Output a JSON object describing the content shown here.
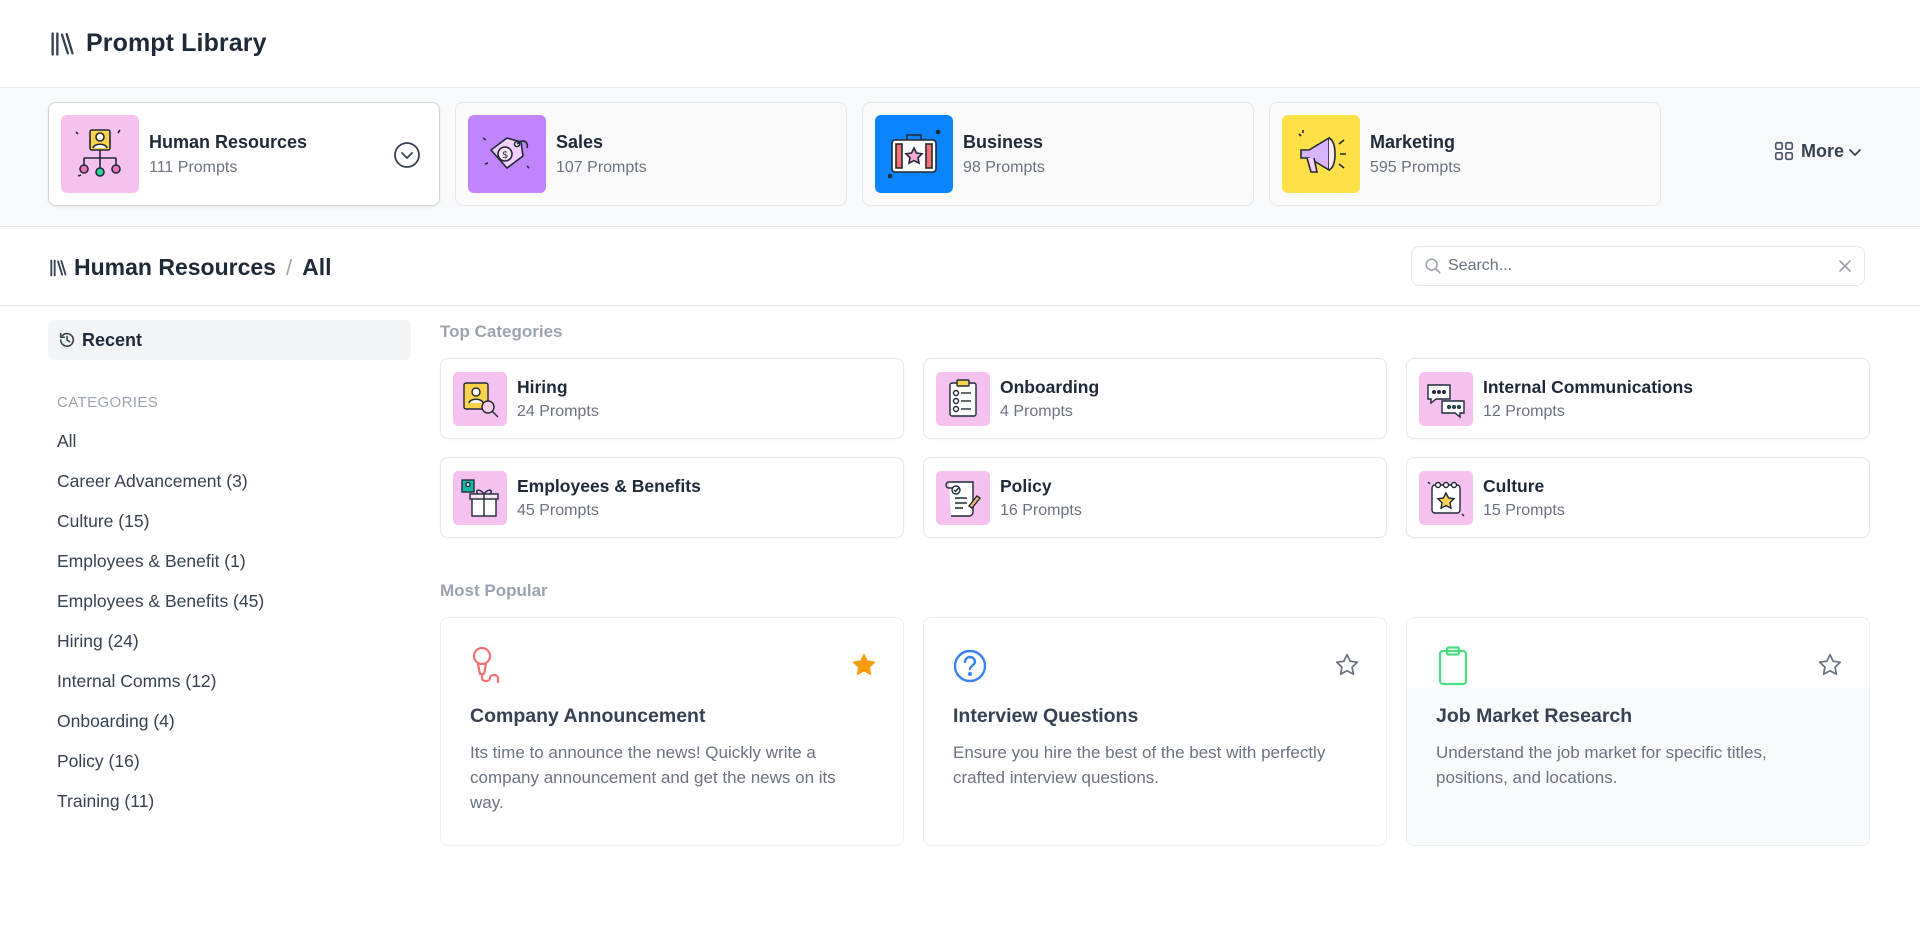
{
  "app": {
    "title": "Prompt Library"
  },
  "categories_strip": [
    {
      "name": "Human Resources",
      "count": "111 Prompts",
      "thumb_color": "#f5c2f0",
      "icon": "org-chart-icon"
    },
    {
      "name": "Sales",
      "count": "107 Prompts",
      "thumb_color": "#c084fc",
      "icon": "price-tag-icon"
    },
    {
      "name": "Business",
      "count": "98 Prompts",
      "thumb_color": "#0a84ff",
      "icon": "briefcase-icon"
    },
    {
      "name": "Marketing",
      "count": "595 Prompts",
      "thumb_color": "#fde047",
      "icon": "megaphone-icon"
    }
  ],
  "more": {
    "label": "More"
  },
  "breadcrumb": {
    "section": "Human Resources",
    "separator": "/",
    "current": "All"
  },
  "search": {
    "placeholder": "Search..."
  },
  "sidebar": {
    "recent_label": "Recent",
    "heading": "CATEGORIES",
    "items": [
      "All",
      "Career Advancement (3)",
      "Culture (15)",
      "Employees & Benefit (1)",
      "Employees & Benefits (45)",
      "Hiring (24)",
      "Internal Comms (12)",
      "Onboarding (4)",
      "Policy (16)",
      "Training (11)"
    ]
  },
  "top_categories": {
    "title": "Top Categories",
    "items": [
      {
        "name": "Hiring",
        "count": "24 Prompts",
        "icon": "magnifier-person-icon"
      },
      {
        "name": "Onboarding",
        "count": "4 Prompts",
        "icon": "checklist-icon"
      },
      {
        "name": "Internal Communications",
        "count": "12 Prompts",
        "icon": "chat-bubbles-icon"
      },
      {
        "name": "Employees & Benefits",
        "count": "45 Prompts",
        "icon": "gift-icon"
      },
      {
        "name": "Policy",
        "count": "16 Prompts",
        "icon": "scroll-icon"
      },
      {
        "name": "Culture",
        "count": "15 Prompts",
        "icon": "calendar-star-icon"
      }
    ]
  },
  "most_popular": {
    "title": "Most Popular",
    "items": [
      {
        "name": "Company Announcement",
        "description": "Its time to announce the news! Quickly write a company announcement and get the news on its way.",
        "icon": "microphone-icon",
        "icon_color": "#f87171",
        "starred": true
      },
      {
        "name": "Interview Questions",
        "description": "Ensure you hire the best of the best with perfectly crafted interview questions.",
        "icon": "question-circle-icon",
        "icon_color": "#3b82f6",
        "starred": false
      },
      {
        "name": "Job Market Research",
        "description": "Understand the job market for specific titles, positions, and locations.",
        "icon": "clipboard-icon",
        "icon_color": "#4ade80",
        "starred": false
      }
    ]
  },
  "colors": {
    "star_active": "#f59e0b",
    "star_inactive": "#6b7280",
    "thumb_pink": "#f5c2f0"
  }
}
